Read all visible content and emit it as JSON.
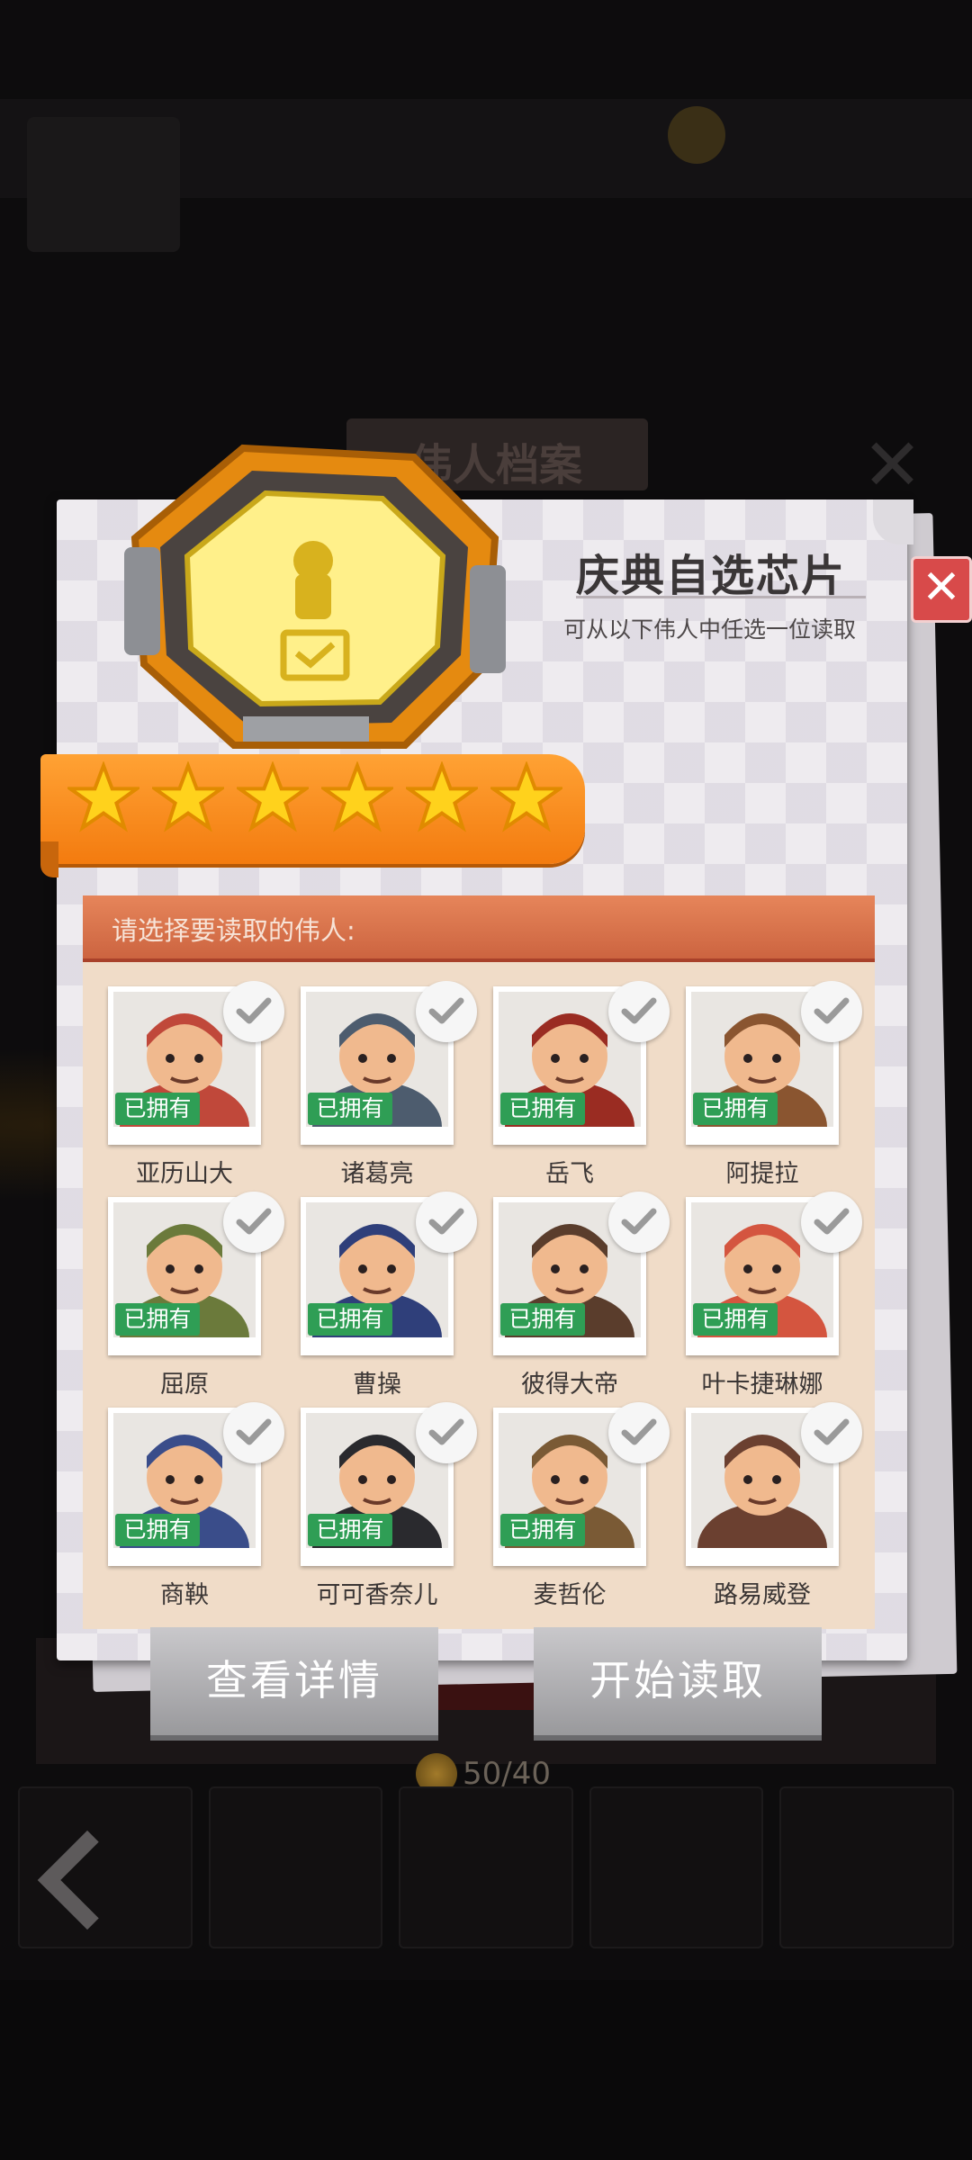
{
  "background": {
    "section_tag": "伟人档案",
    "count": "50/40"
  },
  "modal": {
    "title": "庆典自选芯片",
    "subtitle": "可从以下伟人中任选一位读取",
    "close_label": "✕",
    "star_count": 6,
    "list_header": "请选择要读取的伟人:",
    "owned_label": "已拥有",
    "heroes": [
      {
        "name": "亚历山大",
        "owned": true,
        "checked": true,
        "color": "#c0483a"
      },
      {
        "name": "诸葛亮",
        "owned": true,
        "checked": true,
        "color": "#4d5c6e"
      },
      {
        "name": "岳飞",
        "owned": true,
        "checked": true,
        "color": "#9a2c22"
      },
      {
        "name": "阿提拉",
        "owned": true,
        "checked": true,
        "color": "#8a5530"
      },
      {
        "name": "屈原",
        "owned": true,
        "checked": true,
        "color": "#6b7a3b"
      },
      {
        "name": "曹操",
        "owned": true,
        "checked": true,
        "color": "#2f3f7a"
      },
      {
        "name": "彼得大帝",
        "owned": true,
        "checked": true,
        "color": "#5a3d2c"
      },
      {
        "name": "叶卡捷琳娜",
        "owned": true,
        "checked": true,
        "color": "#d4553f"
      },
      {
        "name": "商鞅",
        "owned": true,
        "checked": true,
        "color": "#3a4d8a"
      },
      {
        "name": "可可香奈儿",
        "owned": true,
        "checked": true,
        "color": "#2a2a2e"
      },
      {
        "name": "麦哲伦",
        "owned": true,
        "checked": true,
        "color": "#7a5a35"
      },
      {
        "name": "路易威登",
        "owned": false,
        "checked": true,
        "color": "#6b4030"
      }
    ],
    "buttons": {
      "details": "查看详情",
      "start": "开始读取"
    }
  },
  "colors": {
    "owned_badge": "#2f9e55",
    "close_button": "#d84a4a",
    "ribbon": "#f68d1e",
    "list_header": "#d96f4a"
  }
}
